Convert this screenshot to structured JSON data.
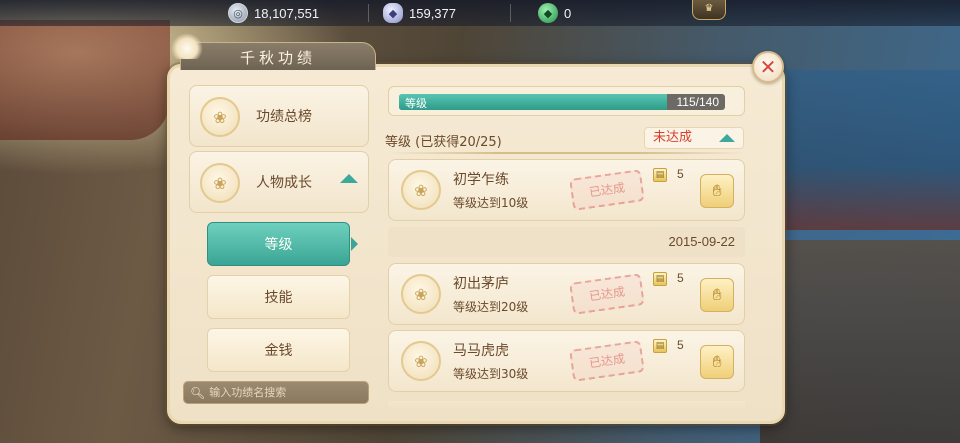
{
  "resources": {
    "coins": "18,107,551",
    "silver": "159,377",
    "jade": "0",
    "coin_icon": "coin-icon",
    "silver_icon": "silver-ingot-icon",
    "jade_icon": "jade-gem-icon"
  },
  "panel": {
    "title": "千秋功绩"
  },
  "nav": {
    "leaderboard_label": "功绩总榜",
    "growth_label": "人物成长",
    "sub_items": [
      {
        "label": "等级",
        "active": true
      },
      {
        "label": "技能",
        "active": false
      },
      {
        "label": "金钱",
        "active": false
      }
    ],
    "search_placeholder": "输入功绩名搜索"
  },
  "progress": {
    "label": "等级",
    "current": 115,
    "max": 140,
    "text": "115/140"
  },
  "section": {
    "header": "等级 (已获得20/25)",
    "status": "未达成"
  },
  "achievements": [
    {
      "name": "初学乍练",
      "desc": "等级达到10级",
      "reward_count": "5",
      "stamp": "已达成"
    },
    {
      "name": "初出茅庐",
      "desc": "等级达到20级",
      "reward_count": "5",
      "stamp": "已达成"
    },
    {
      "name": "马马虎虎",
      "desc": "等级达到30级",
      "reward_count": "5",
      "stamp": "已达成"
    }
  ],
  "date": "2015-09-22",
  "colors": {
    "accent_teal": "#3aa595",
    "status_red": "#d6402f",
    "text_brown": "#6b4a2c",
    "panel_bg": "#f6ead4"
  }
}
